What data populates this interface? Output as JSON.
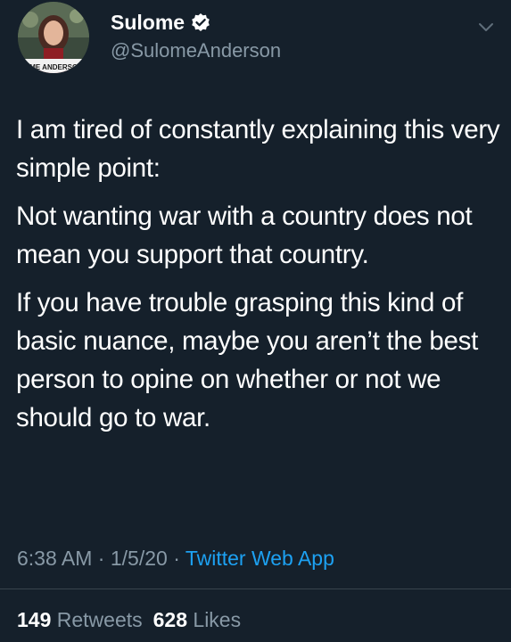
{
  "author": {
    "display_name": "Sulome",
    "handle": "@SulomeAnderson",
    "avatar_caption": "OME ANDERSON"
  },
  "tweet": {
    "paragraphs": [
      "I am tired of constantly explaining this very simple point:",
      "Not wanting war with a country does not mean you support that country.",
      "If you have trouble grasping this kind of basic nuance, maybe you aren’t the best person to opine on whether or not we should go to war."
    ],
    "time": "6:38 AM",
    "date": "1/5/20",
    "separator": "·",
    "source": "Twitter Web App"
  },
  "stats": {
    "retweets_count": "149",
    "retweets_label": "Retweets",
    "likes_count": "628",
    "likes_label": "Likes"
  },
  "colors": {
    "background": "#15202b",
    "primary_text": "#ffffff",
    "secondary_text": "#8899a6",
    "link": "#1da1f2",
    "divider": "#38444d"
  },
  "icons": {
    "verified": "verified-badge-icon",
    "menu": "chevron-down-icon"
  }
}
